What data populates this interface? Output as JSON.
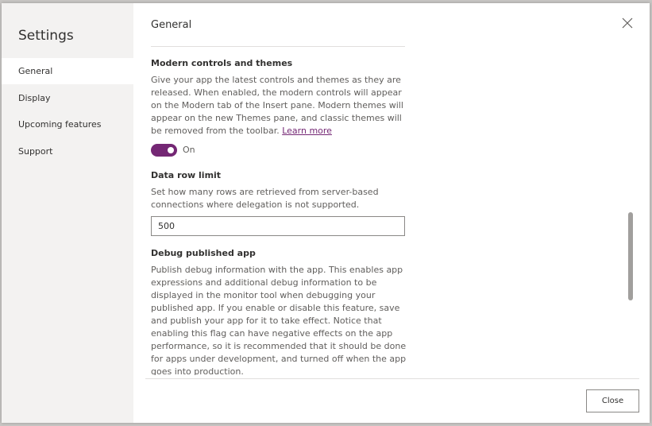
{
  "sidebar": {
    "title": "Settings",
    "items": [
      {
        "label": "General",
        "selected": true
      },
      {
        "label": "Display",
        "selected": false
      },
      {
        "label": "Upcoming features",
        "selected": false
      },
      {
        "label": "Support",
        "selected": false
      }
    ]
  },
  "main": {
    "title": "General",
    "close_icon": "close-icon",
    "sections": {
      "modern": {
        "title": "Modern controls and themes",
        "description": "Give your app the latest controls and themes as they are released. When enabled, the modern controls will appear on the Modern tab of the Insert pane. Modern themes will appear on the new Themes pane, and classic themes will be removed from the toolbar.",
        "link": "Learn more",
        "toggle_on": true,
        "toggle_label": "On"
      },
      "rowlimit": {
        "title": "Data row limit",
        "description": "Set how many rows are retrieved from server-based connections where delegation is not supported.",
        "value": "500"
      },
      "debug": {
        "title": "Debug published app",
        "description": "Publish debug information with the app. This enables app expressions and additional debug information to be displayed in the monitor tool when debugging your published app. If you enable or disable this feature, save and publish your app for it to take effect. Notice that enabling this flag can have negative effects on the app performance, so it is recommended that it should be done for apps under development, and turned off when the app goes into production."
      }
    }
  },
  "footer": {
    "close_label": "Close"
  },
  "colors": {
    "accent": "#742774",
    "sidebar_bg": "#f3f2f1"
  }
}
